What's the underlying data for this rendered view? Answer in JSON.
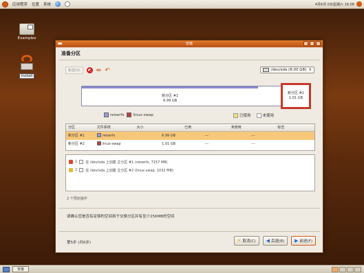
{
  "topbar": {
    "menu": [
      "应用程序",
      "位置",
      "系统"
    ],
    "clock": "4月6月 0日星期六 16:08"
  },
  "desktop": {
    "icons": [
      {
        "label": "Examples"
      },
      {
        "label": "Install"
      }
    ]
  },
  "window": {
    "title": "安装",
    "heading": "准备分区",
    "toolbar": {
      "new_label": "新建(N)"
    },
    "device": "/dev/sda  (8.00 GB)",
    "partition_bar": {
      "seg1_name": "新分区 #1",
      "seg1_size": "6.99 GB",
      "seg2_name": "新分区 #2",
      "seg2_size": "1.01 GB",
      "seg1_color": "#8a8ad0",
      "selected_color": "#c8382a"
    },
    "legend": {
      "fs1": "reiserfs",
      "fs1_color": "#9a9ad8",
      "fs2": "linux-swap",
      "fs2_color": "#c43a3a",
      "used": "已使用",
      "used_color": "#f0e07a",
      "unused": "未使用",
      "unused_color": "#ffffff"
    },
    "table": {
      "headers": [
        "分区",
        "文件系统",
        "大小",
        "已用",
        "未使用",
        "标志"
      ],
      "rows": [
        {
          "partition": "新分区 #1",
          "fs": "reiserfs",
          "fs_color": "#9a9ad8",
          "size": "6.99 GB",
          "used": "---",
          "unused": "---",
          "flags": ""
        },
        {
          "partition": "新分区 #2",
          "fs": "linux-swap",
          "fs_color": "#c43a3a",
          "size": "1.01 GB",
          "used": "---",
          "unused": "---",
          "flags": ""
        }
      ]
    },
    "operations": [
      {
        "num": "1",
        "text": "在 /dev/sda 上创建 主分区 #1 (reiserfs, 7157 MB)",
        "icon_color": "#d84a2a"
      },
      {
        "num": "2",
        "text": "在 /dev/sda 上创建 主分区 #2 (linux-swap, 1032 MB)",
        "icon_color": "#e8b830"
      }
    ],
    "pending": "2 个预定操作",
    "notice": "请确认您是否有足够的空间用于交换分区并有至少256MB的空间",
    "step": "第5步 (共6步)",
    "buttons": {
      "cancel": "取消(C)",
      "back": "后退(B)",
      "forward": "前进(F)"
    }
  },
  "taskbar": {
    "task": "安装"
  }
}
